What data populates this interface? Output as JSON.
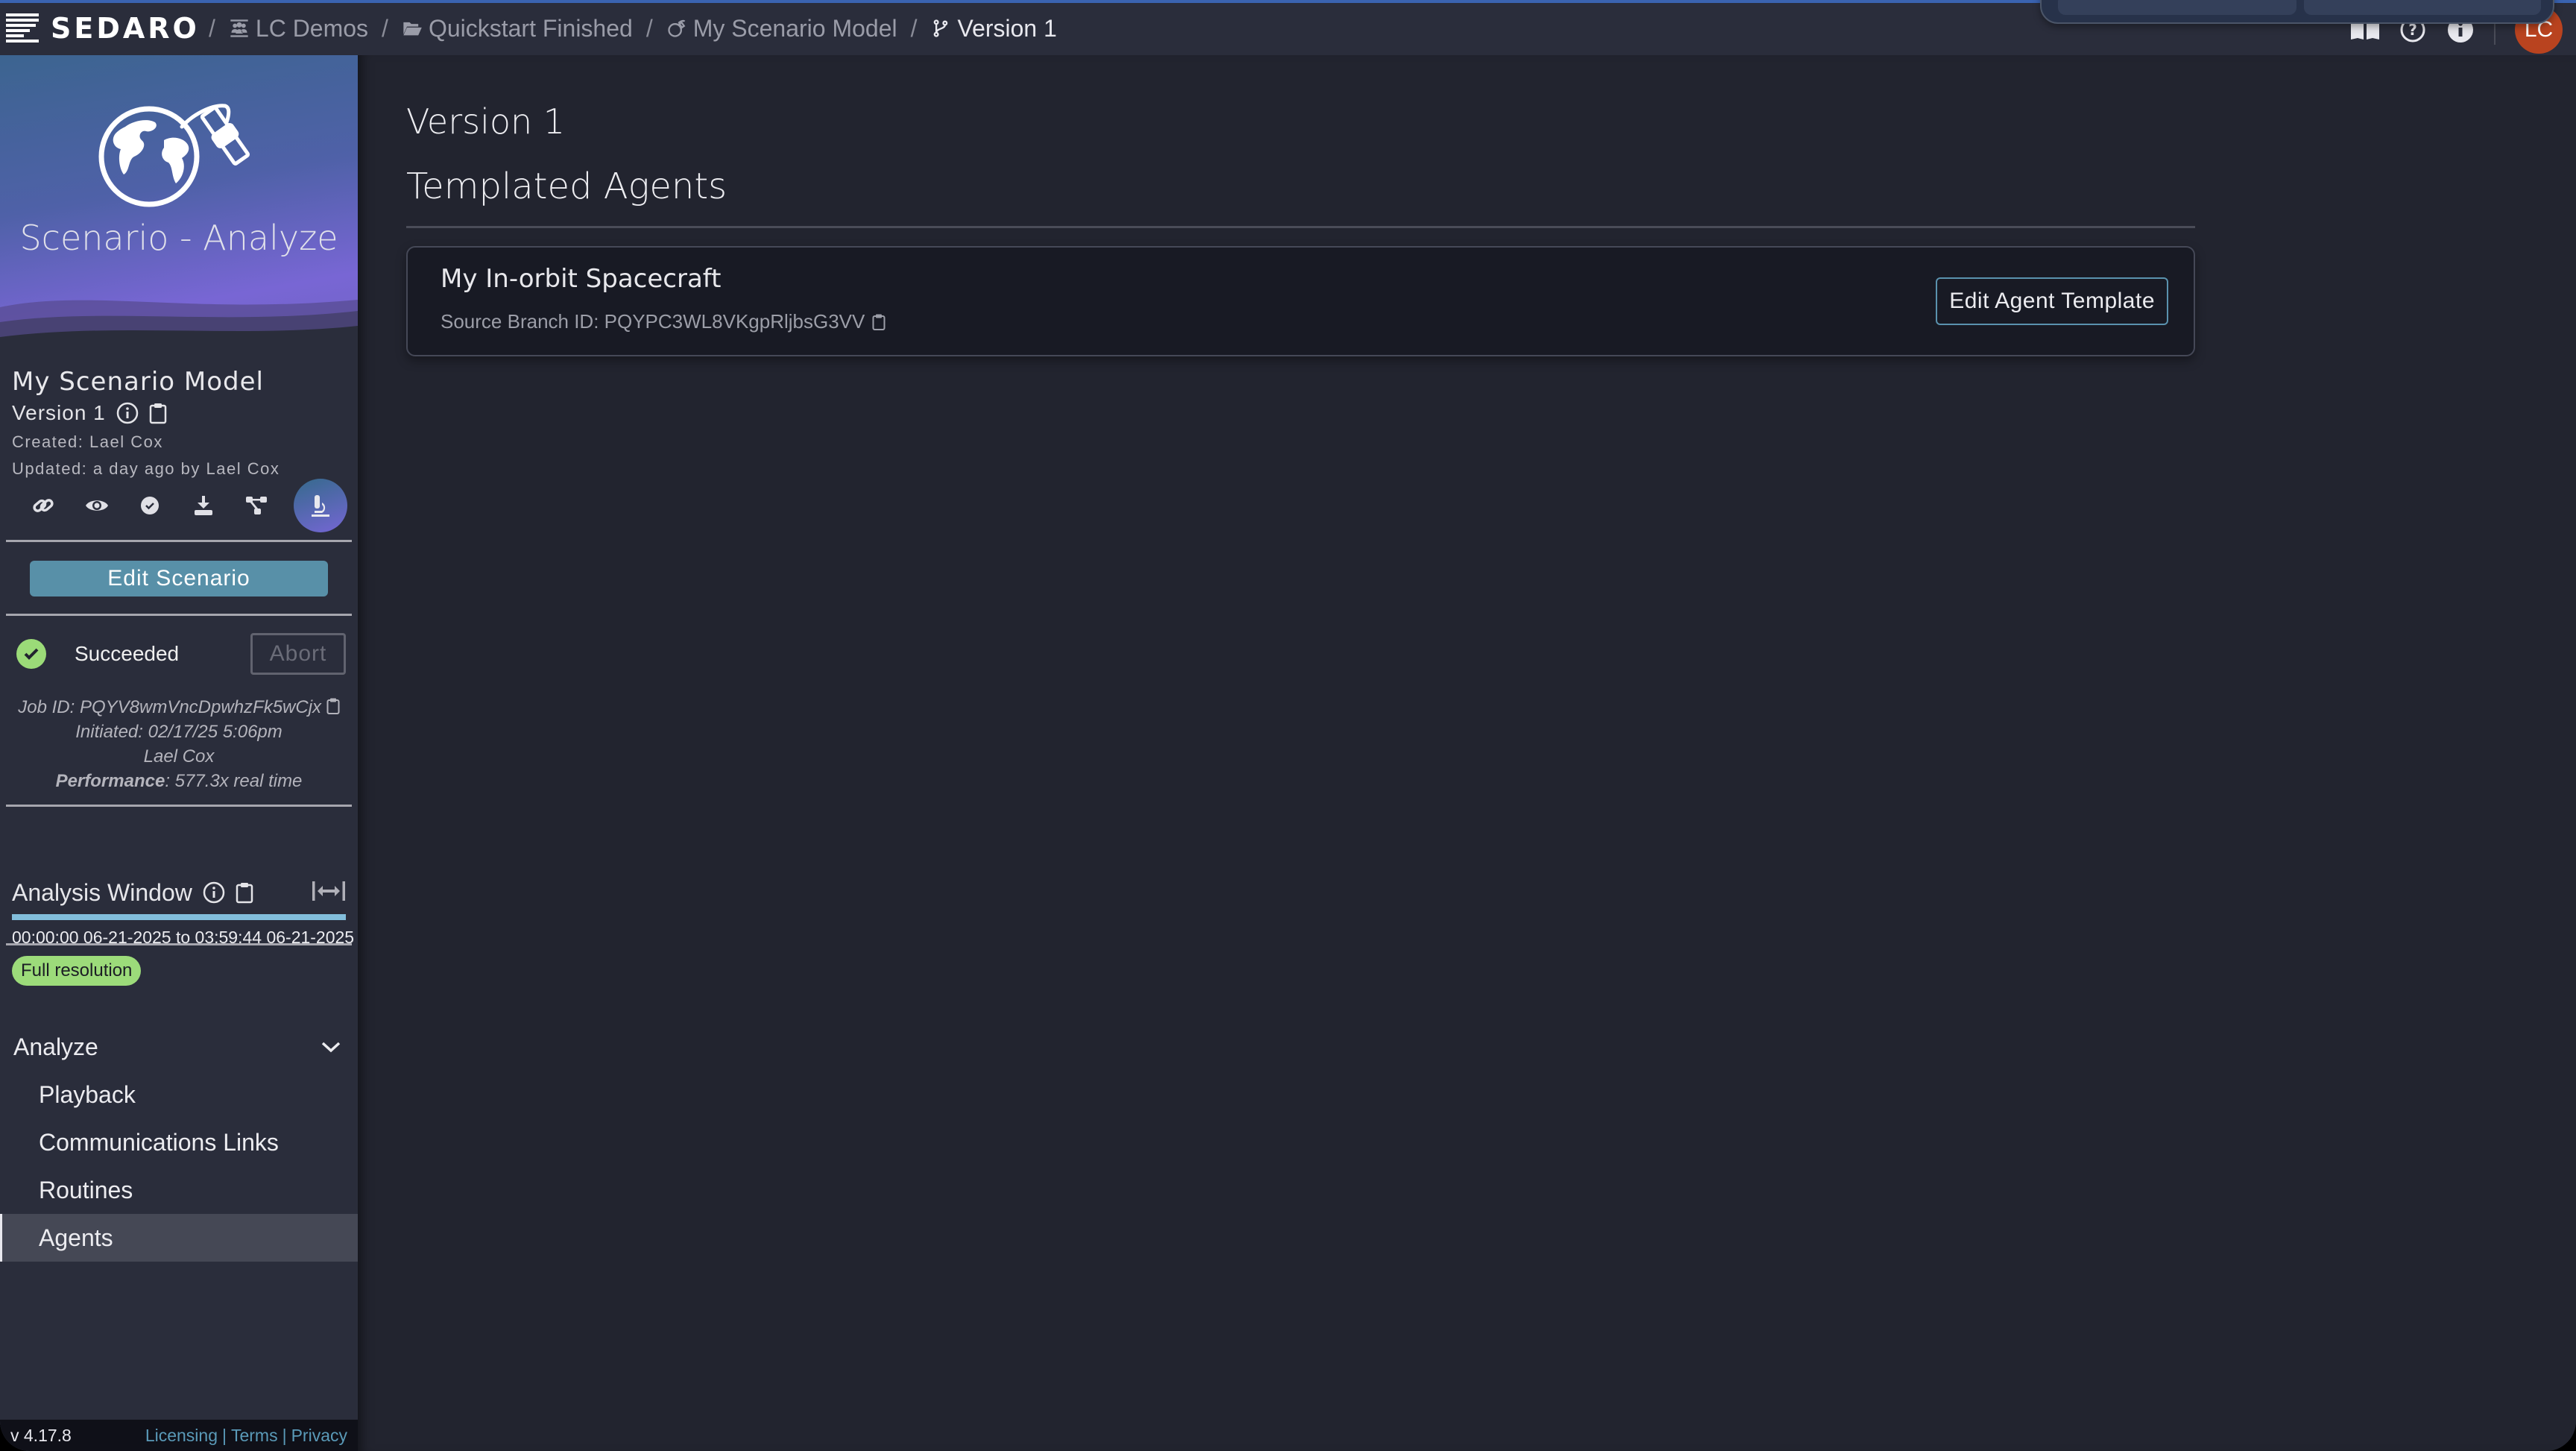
{
  "app": {
    "brand": "SEDARO",
    "accent_color": "#5890a8",
    "success_color": "#9bdb78",
    "avatar_color": "#b9431f"
  },
  "breadcrumb": [
    {
      "label": "LC Demos",
      "icon": "users-icon"
    },
    {
      "label": "Quickstart Finished",
      "icon": "folder-open-icon"
    },
    {
      "label": "My Scenario Model",
      "icon": "globe-satellite-icon"
    },
    {
      "label": "Version 1",
      "icon": "branch-icon"
    }
  ],
  "header": {
    "actions": [
      {
        "name": "docs-icon",
        "label": "Documentation"
      },
      {
        "name": "help-icon",
        "label": "Help"
      },
      {
        "name": "info-icon",
        "label": "Info"
      }
    ],
    "avatar_initials": "LC"
  },
  "sidebar": {
    "hero_title": "Scenario - Analyze",
    "model_name": "My Scenario Model",
    "version": "Version 1",
    "created": "Created: Lael Cox",
    "updated": "Updated: a day ago by Lael Cox",
    "tools": [
      {
        "name": "link-icon",
        "label": "Link"
      },
      {
        "name": "eye-icon",
        "label": "View"
      },
      {
        "name": "check-circle-icon",
        "label": "Validate"
      },
      {
        "name": "download-icon",
        "label": "Download"
      },
      {
        "name": "branches-icon",
        "label": "Branches"
      },
      {
        "name": "microscope-icon",
        "label": "Analyze",
        "active": true
      }
    ],
    "edit_scenario_label": "Edit Scenario",
    "job": {
      "status": "Succeeded",
      "abort_label": "Abort",
      "job_id": "Job ID: PQYV8wmVncDpwhzFk5wCjx",
      "initiated": "Initiated: 02/17/25 5:06pm",
      "user": "Lael Cox",
      "performance_label": "Performance",
      "performance_value": ": 577.3x real time"
    },
    "analysis_window": {
      "title": "Analysis Window",
      "range": "00:00:00 06-21-2025 to 03:59:44 06-21-2025",
      "resolution_badge": "Full resolution",
      "coverage_fraction": 1.0
    },
    "nav": {
      "group_label": "Analyze",
      "items": [
        {
          "label": "Playback",
          "active": false
        },
        {
          "label": "Communications Links",
          "active": false
        },
        {
          "label": "Routines",
          "active": false
        },
        {
          "label": "Agents",
          "active": true
        }
      ]
    },
    "footer": {
      "version": "v 4.17.8",
      "links": [
        "Licensing",
        "Terms",
        "Privacy"
      ],
      "separator": "|"
    }
  },
  "main": {
    "page_title": "Version 1",
    "section_title": "Templated Agents",
    "agents": [
      {
        "name": "My In-orbit Spacecraft",
        "source_branch": "Source Branch ID: PQYPC3WL8VKgpRljbsG3VV",
        "action_label": "Edit Agent Template"
      }
    ]
  }
}
